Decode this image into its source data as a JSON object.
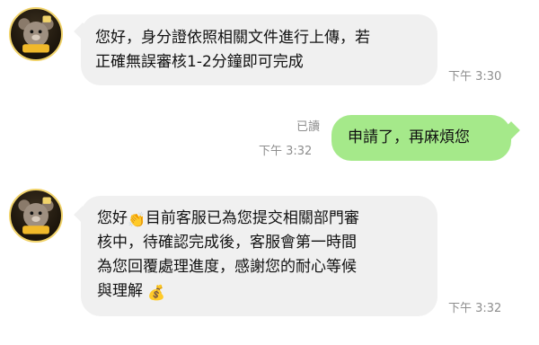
{
  "messages": [
    {
      "sender": "agent",
      "text": "您好，身分證依照相關文件進行上傳，若\n正確無誤審核1-2分鐘即可完成",
      "time": "下午 3:30"
    },
    {
      "sender": "user",
      "text": "申請了，再麻煩您",
      "read_status": "已讀",
      "time": "下午 3:32"
    },
    {
      "sender": "agent",
      "text_parts": {
        "greeting": "您好",
        "wave_emoji": "👏",
        "line1": "目前客服已為您提交相關部門審",
        "line2": "核中，待確認完成後，客服會第一時間",
        "line3": "為您回覆處理進度，感謝您的耐心等候",
        "line4": "與理解",
        "bag_emoji": "💰"
      },
      "time": "下午 3:32"
    }
  ],
  "avatar": {
    "icon": "bear-mascot-icon",
    "accent": "#f1d36a"
  },
  "colors": {
    "incoming_bubble": "#f0f0f0",
    "outgoing_bubble": "#a5e98a",
    "timestamp": "#8e8e8e"
  }
}
